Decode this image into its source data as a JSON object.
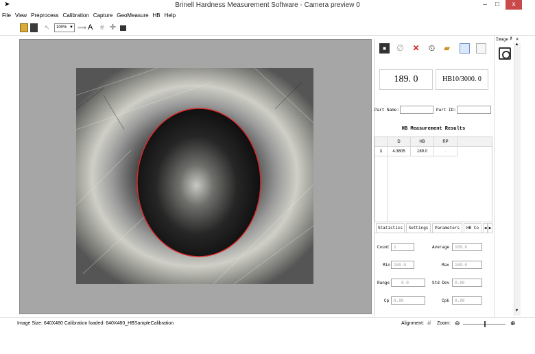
{
  "window": {
    "title": "Brinell Hardness Measurement Software - Camera preview 0",
    "close_glyph": "x",
    "min_glyph": "–",
    "max_glyph": "□"
  },
  "menu": [
    "File",
    "View",
    "Preprocess",
    "Calibration",
    "Capture",
    "GeoMeasure",
    "HB",
    "Help"
  ],
  "toolbar": {
    "zoom_value": "100%",
    "text_tool": "A"
  },
  "panel": {
    "hb_value": "189. 0",
    "hb_scale": "HB10/3000. 0",
    "part_name_label": "Part Name:",
    "part_id_label": "Part ID:",
    "results_title": "HB Measurement Results",
    "columns": [
      "D",
      "HB",
      "RP"
    ],
    "rows": [
      {
        "index": "1",
        "d": "4.3805",
        "hb": "189.0",
        "rp": "-"
      }
    ],
    "tabs": [
      "Statistics",
      "Settings",
      "Parameters",
      "HB Co"
    ],
    "stats": {
      "count_label": "Count",
      "count_value": "1",
      "average_label": "Average",
      "average_value": "189.0",
      "min_label": "Min",
      "min_value": "189.0",
      "max_label": "Max",
      "max_value": "189.0",
      "range_label": "Range",
      "range_value": "0.0",
      "stddev_label": "Std Dev",
      "stddev_value": "0.00",
      "cp_label": "Cp",
      "cp_value": "0.00",
      "cpk_label": "Cpk",
      "cpk_value": "0.00"
    }
  },
  "image_sidebar": {
    "title": "Image"
  },
  "status": {
    "left": "Image Size: 640X480  Calibration loaded: 640X480_HBSampleCalibration",
    "alignment_label": "Alignment:",
    "zoom_label": "Zoom:"
  }
}
